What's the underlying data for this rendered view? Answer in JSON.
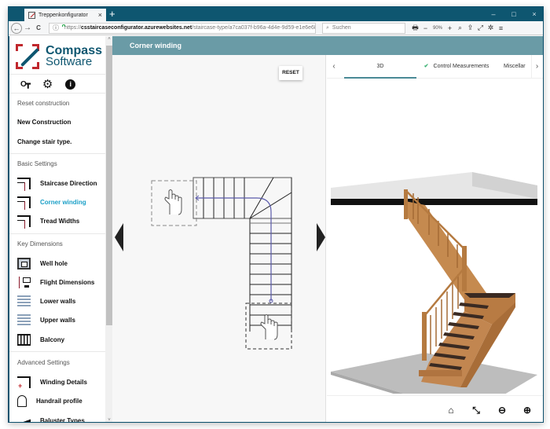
{
  "browser": {
    "tab_title": "Treppenkonfigurator",
    "tab_close": "×",
    "new_tab": "+",
    "window_controls": {
      "minimize": "–",
      "maximize": "□",
      "close": "×"
    },
    "nav": {
      "back": "←",
      "forward": "→",
      "reload": "C"
    },
    "url": {
      "prefix": "https://",
      "host": "csstaircaseconfigurator.azurewebsites.net",
      "path": "/staircase-type/a7ca037f-b96a-4d4e-9d59-e1e6e68r"
    },
    "page_actions": "···",
    "search_placeholder": "Suchen",
    "zoom_level": "90%",
    "tools": {
      "print": "🖶",
      "zoom_out": "−",
      "zoom_in": "+",
      "find": "⌕",
      "upload": "⇪",
      "fullscreen": "⤢",
      "settings": "✲",
      "menu": "≡"
    }
  },
  "sidebar": {
    "logo": {
      "line1": "Compass",
      "line2": "Software"
    },
    "top_icons": {
      "key": "O┳",
      "gear": "⚙",
      "info": "i"
    },
    "reset_section": "Reset construction",
    "reset_items": [
      "New Construction",
      "Change stair type."
    ],
    "sections": [
      {
        "title": "Basic Settings",
        "items": [
          {
            "label": "Staircase Direction",
            "icon": "staircase-direction-icon"
          },
          {
            "label": "Corner winding",
            "icon": "corner-winding-icon",
            "active": true
          },
          {
            "label": "Tread Widths",
            "icon": "tread-widths-icon"
          }
        ]
      },
      {
        "title": "Key Dimensions",
        "items": [
          {
            "label": "Well hole",
            "icon": "well-hole-icon"
          },
          {
            "label": "Flight Dimensions",
            "icon": "flight-dimensions-icon"
          },
          {
            "label": "Lower walls",
            "icon": "lower-walls-icon"
          },
          {
            "label": "Upper walls",
            "icon": "upper-walls-icon"
          },
          {
            "label": "Balcony",
            "icon": "balcony-icon"
          }
        ]
      },
      {
        "title": "Advanced Settings",
        "items": [
          {
            "label": "Winding Details",
            "icon": "winding-details-icon"
          },
          {
            "label": "Handrail profile",
            "icon": "handrail-profile-icon"
          },
          {
            "label": "Baluster Types",
            "icon": "baluster-types-icon"
          }
        ]
      }
    ],
    "scroll_up": "˄",
    "scroll_down": "˅"
  },
  "header": {
    "title": "Corner winding"
  },
  "plan": {
    "reset_label": "RESET"
  },
  "view3d": {
    "tabs": [
      "3D",
      "Control Measurements",
      "Miscellar"
    ],
    "active_tab": "3D",
    "check": "✔",
    "chevron_left": "‹",
    "chevron_right": "›",
    "tools": {
      "home": "⌂",
      "fit": "⤡",
      "zoom_out": "⊖",
      "zoom_in": "⊕"
    }
  },
  "colors": {
    "brand": "#0e5670",
    "header": "#6a9ba6",
    "active": "#1a9fc7",
    "logo_red": "#c0272d",
    "walk_line": "#5a5aaa"
  }
}
